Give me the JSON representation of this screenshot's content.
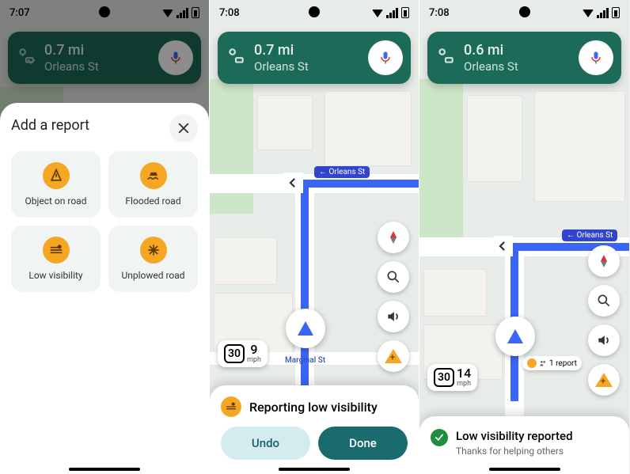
{
  "screens": [
    {
      "time": "7:07",
      "nav": {
        "distance": "0.7 mi",
        "street": "Orleans St"
      },
      "sheet": {
        "title": "Add a report",
        "options": [
          {
            "label": "Object on road",
            "icon": "object-on-road-icon"
          },
          {
            "label": "Flooded road",
            "icon": "flooded-road-icon"
          },
          {
            "label": "Low visibility",
            "icon": "low-visibility-icon"
          },
          {
            "label": "Unplowed road",
            "icon": "unplowed-road-icon"
          }
        ]
      }
    },
    {
      "time": "7:08",
      "nav": {
        "distance": "0.7 mi",
        "street": "Orleans St"
      },
      "map": {
        "turn_label": "Orleans St",
        "bottom_label": "Marginal St"
      },
      "speed": {
        "limit": "30",
        "current": "9",
        "unit": "mph"
      },
      "confirm": {
        "title": "Reporting low visibility",
        "undo": "Undo",
        "done": "Done"
      }
    },
    {
      "time": "7:08",
      "nav": {
        "distance": "0.6 mi",
        "street": "Orleans St"
      },
      "map": {
        "turn_label": "Orleans St",
        "report_badge": "1 report"
      },
      "speed": {
        "limit": "30",
        "current": "14",
        "unit": "mph"
      },
      "reported": {
        "title": "Low visibility reported",
        "subtitle": "Thanks for helping others"
      }
    }
  ],
  "colors": {
    "nav_card": "#1b6b58",
    "accent": "#f5a623",
    "route": "#3b66f5",
    "done": "#1a6b6e",
    "undo": "#d5ecef",
    "success": "#1e8e3e"
  }
}
